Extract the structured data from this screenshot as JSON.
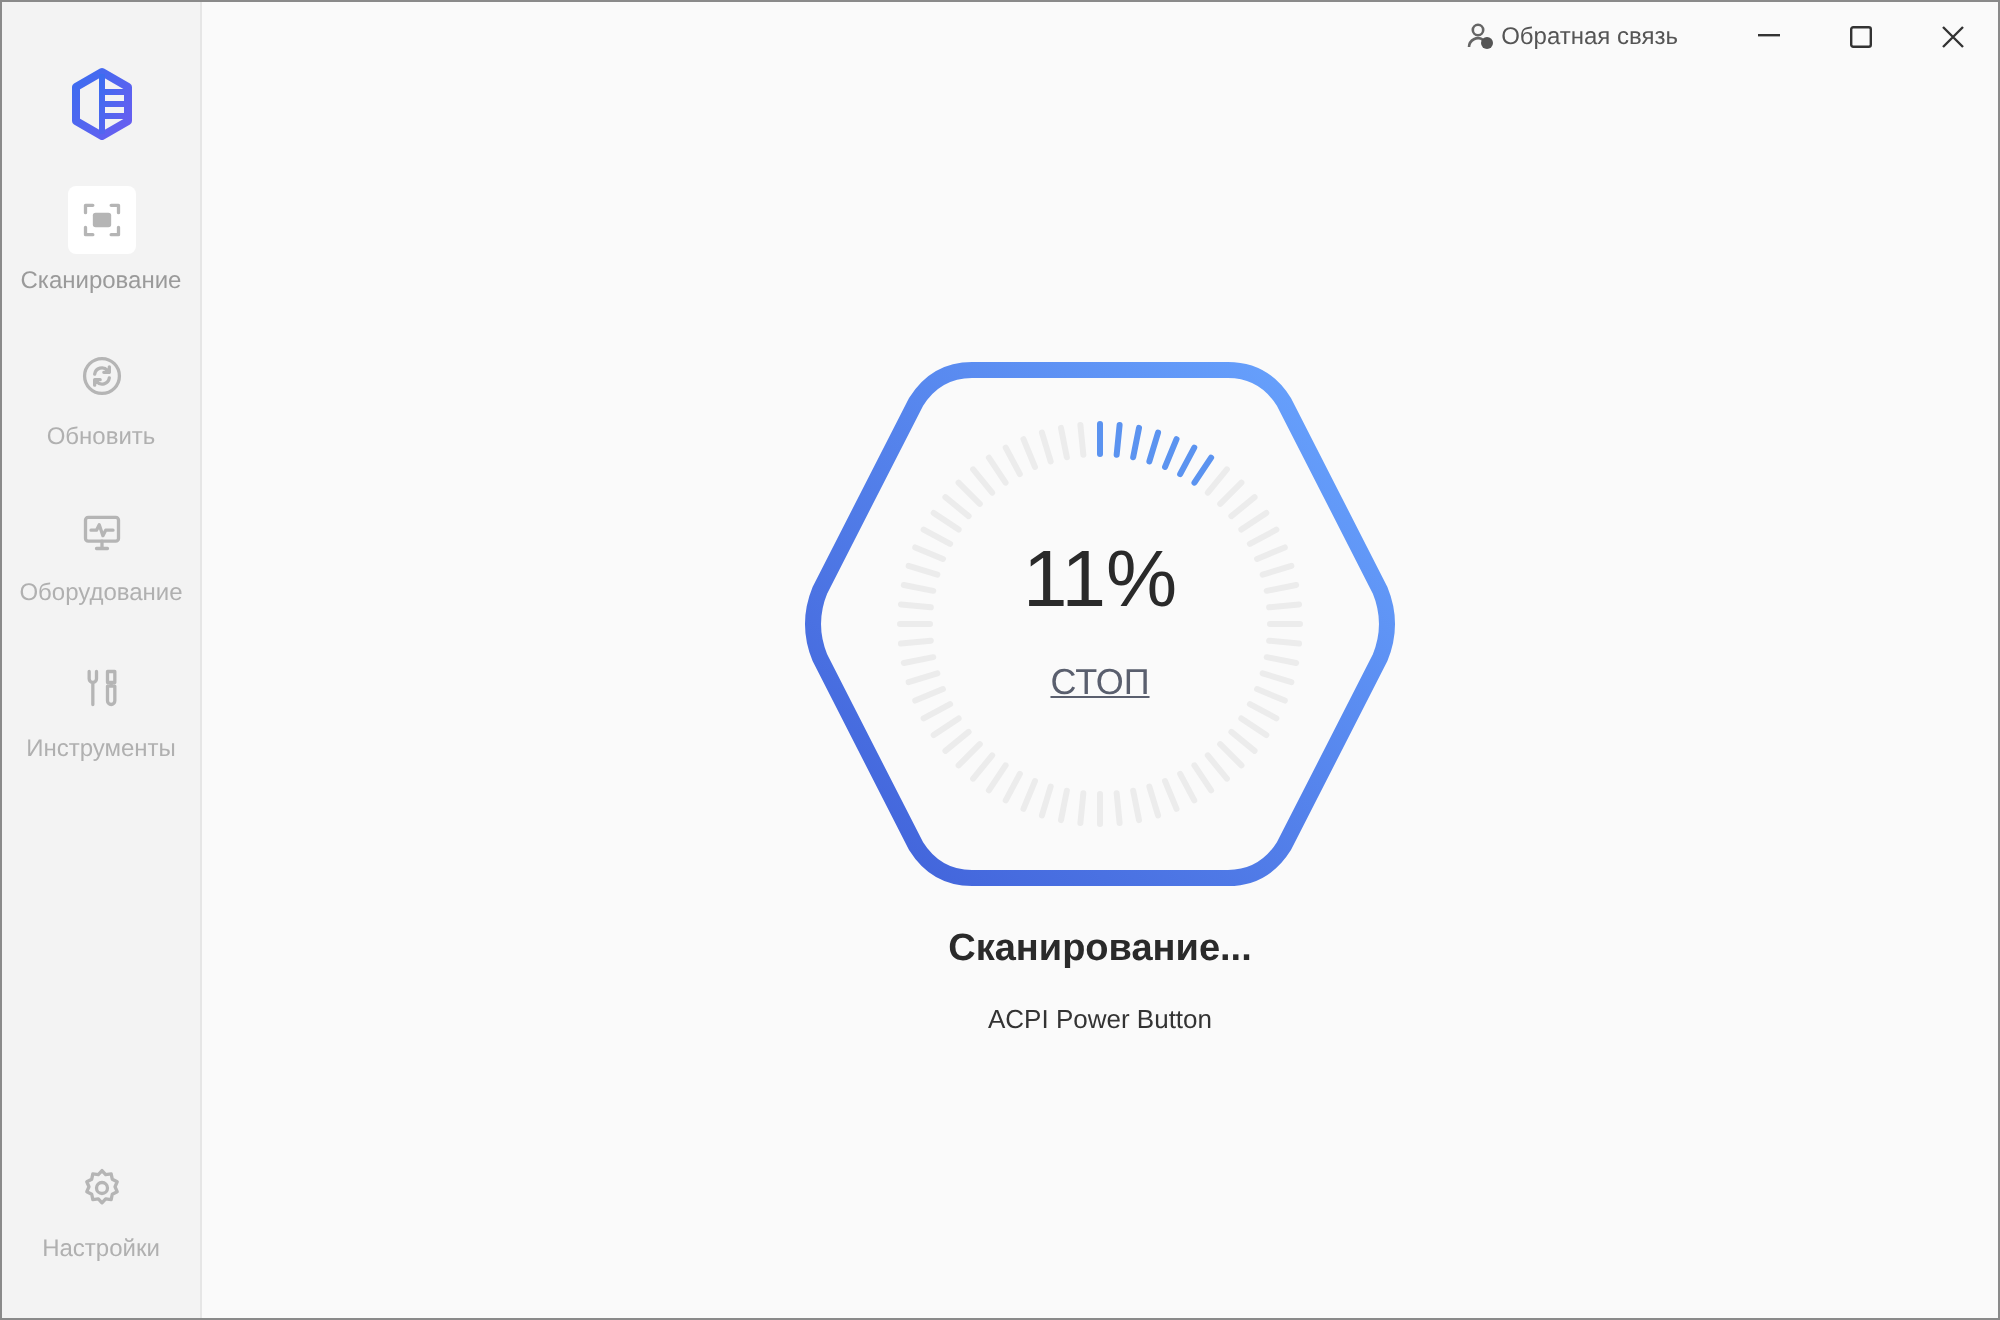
{
  "sidebar": {
    "items": [
      {
        "kind": "scan",
        "label": "Сканирование",
        "selected": true
      },
      {
        "kind": "update",
        "label": "Обновить",
        "selected": false
      },
      {
        "kind": "hardware",
        "label": "Оборудование",
        "selected": false
      },
      {
        "kind": "tools",
        "label": "Инструменты",
        "selected": false
      }
    ],
    "footer": {
      "kind": "settings",
      "label": "Настройки",
      "selected": false
    }
  },
  "titlebar": {
    "feedback": "Обратная связь"
  },
  "scan": {
    "percent": "11%",
    "stop": "СТОП",
    "status": "Сканирование...",
    "device": "ACPI Power Button"
  }
}
